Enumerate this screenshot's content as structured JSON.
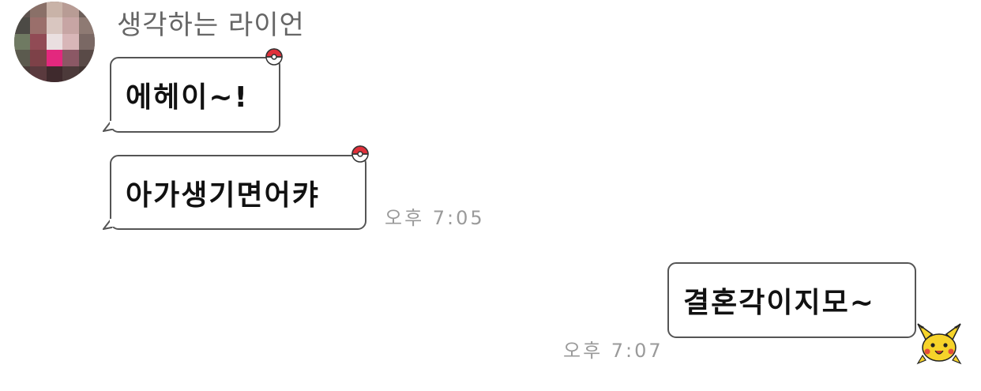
{
  "chat": {
    "sender_name": "생각하는 라이언",
    "messages": [
      {
        "direction": "in",
        "text": "에헤이~!"
      },
      {
        "direction": "in",
        "text": "아가생기면어캬",
        "time": "오후 7:05"
      },
      {
        "direction": "out",
        "text": "결혼각이지모~",
        "time": "오후 7:07"
      }
    ]
  },
  "icons": {
    "incoming_badge": "pokeball-icon",
    "outgoing_badge": "pikachu-icon"
  },
  "colors": {
    "bubble_border": "#555555",
    "sender_text": "#666666",
    "time_text": "#9a9a9a",
    "pokeball_red": "#e0303a"
  }
}
